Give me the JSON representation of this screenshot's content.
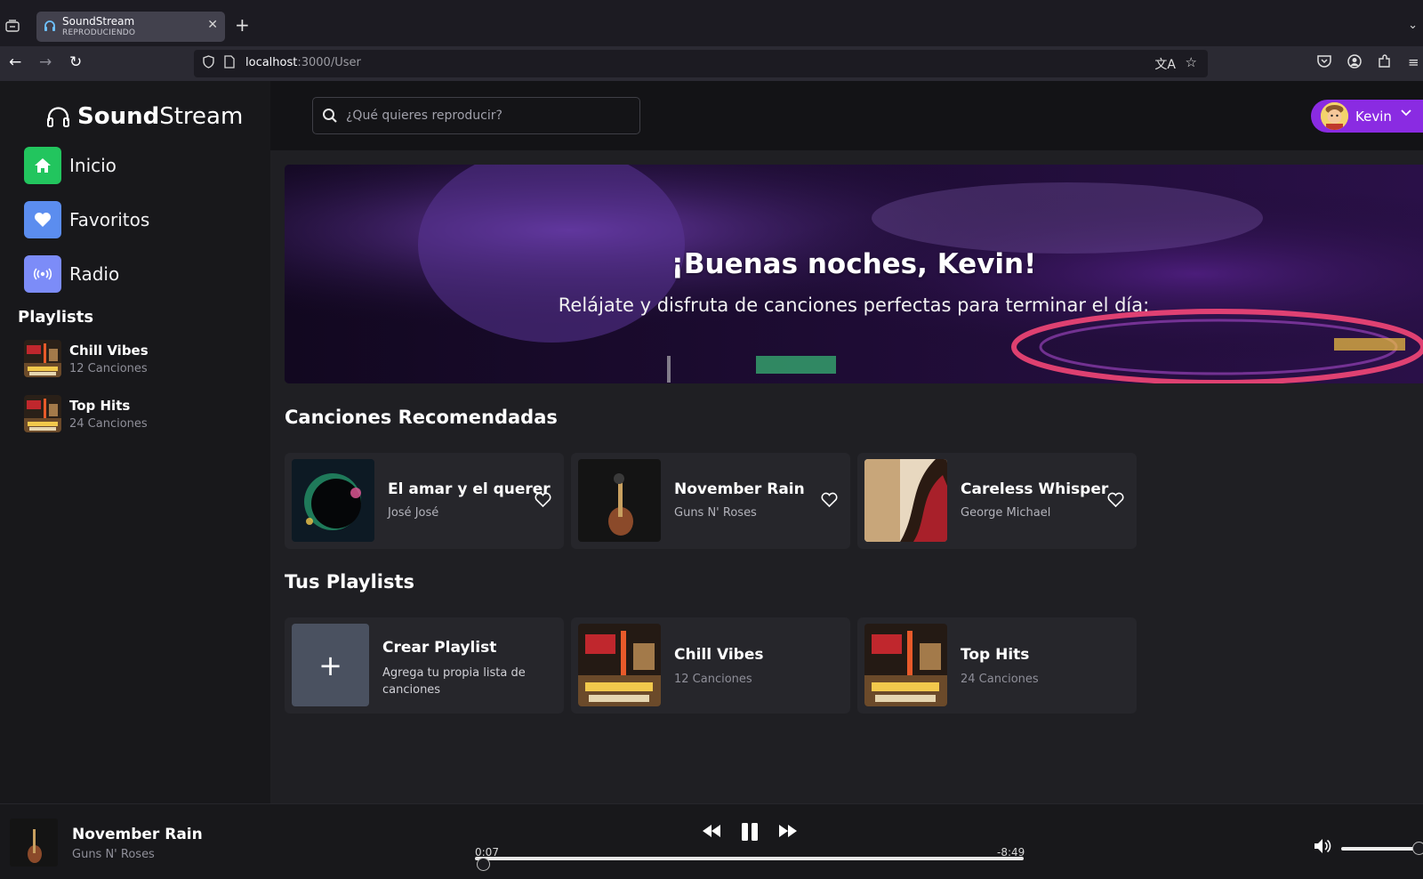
{
  "browser": {
    "tab_title": "SoundStream",
    "tab_subtitle": "REPRODUCIENDO",
    "url_host": "localhost",
    "url_path": ":3000/User"
  },
  "app": {
    "logo_bold": "Sound",
    "logo_light": "Stream",
    "accent_color": "#8a2be2",
    "nav": [
      {
        "label": "Inicio",
        "icon": "home-icon",
        "color": "#22c55e"
      },
      {
        "label": "Favoritos",
        "icon": "heart-icon",
        "color": "#5b8def"
      },
      {
        "label": "Radio",
        "icon": "radio-icon",
        "color": "#7c8cf8"
      }
    ],
    "playlists_heading": "Playlists",
    "sidebar_playlists": [
      {
        "name": "Chill Vibes",
        "count": "12 Canciones"
      },
      {
        "name": "Top Hits",
        "count": "24 Canciones"
      }
    ]
  },
  "search": {
    "placeholder": "¿Qué quieres reproducir?"
  },
  "user": {
    "name": "Kevin"
  },
  "hero": {
    "title": "¡Buenas noches, Kevin!",
    "subtitle": "Relájate y disfruta de canciones perfectas para terminar el día:"
  },
  "recommended": {
    "heading": "Canciones Recomendadas",
    "songs": [
      {
        "title": "El amar y el querer",
        "artist": "José José"
      },
      {
        "title": "November Rain",
        "artist": "Guns N' Roses"
      },
      {
        "title": "Careless Whisper",
        "artist": "George Michael"
      }
    ]
  },
  "your_playlists": {
    "heading": "Tus Playlists",
    "create_title": "Crear Playlist",
    "create_desc": "Agrega tu propia lista de canciones",
    "items": [
      {
        "name": "Chill Vibes",
        "count": "12 Canciones"
      },
      {
        "name": "Top Hits",
        "count": "24 Canciones"
      }
    ]
  },
  "player": {
    "title": "November Rain",
    "artist": "Guns N' Roses",
    "elapsed": "0:07",
    "remaining": "-8:49",
    "progress_fraction": 0.014,
    "volume_fraction": 1.0
  }
}
